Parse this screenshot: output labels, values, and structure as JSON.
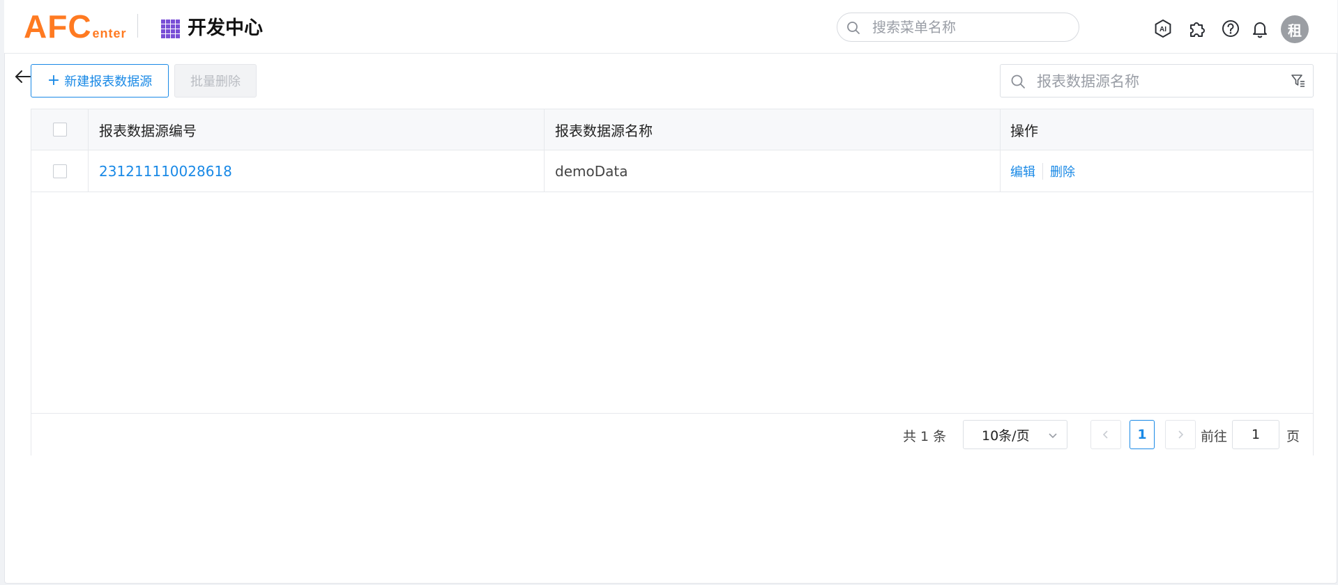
{
  "header": {
    "logo_big": "AFC",
    "logo_small": "enter",
    "app_title": "开发中心",
    "search_placeholder": "搜索菜单名称",
    "icons": [
      "ai-icon",
      "puzzle-icon",
      "help-icon",
      "bell-icon"
    ],
    "avatar_text": "租"
  },
  "toolbar": {
    "new_button_icon": "+",
    "new_button_label": "新建报表数据源",
    "batch_delete_label": "批量删除",
    "search_placeholder": "报表数据源名称"
  },
  "table": {
    "columns": [
      "报表数据源编号",
      "报表数据源名称",
      "操作"
    ],
    "rows": [
      {
        "code": "23121111002861​8",
        "name": "demoData",
        "actions": [
          "编辑",
          "删除"
        ]
      }
    ]
  },
  "pagination": {
    "total_text": "共 1 条",
    "page_size": "10条/页",
    "current_page": "1",
    "goto_label": "前往",
    "goto_value": "1",
    "page_suffix": "页"
  },
  "colors": {
    "brand": "#ff7a21",
    "accent": "#1989e6",
    "grid_icon": "#7a4fd6"
  }
}
